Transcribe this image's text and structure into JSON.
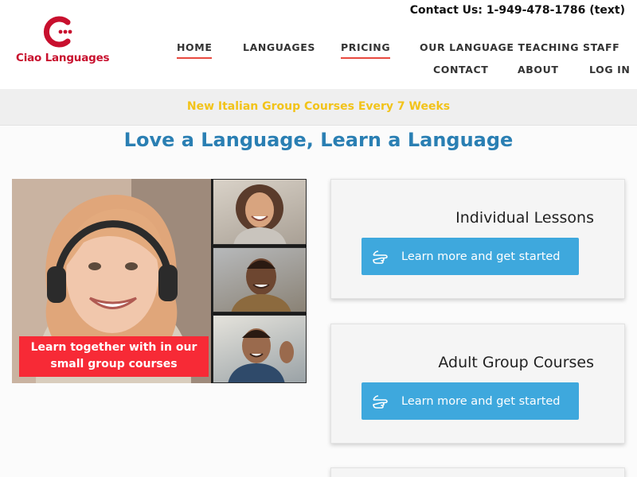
{
  "header": {
    "contact": "Contact Us: 1-949-478-1786 (text)",
    "logo_text": "Ciao Languages",
    "nav": [
      {
        "label": "HOME",
        "active": true
      },
      {
        "label": "LANGUAGES",
        "active": false
      },
      {
        "label": "PRICING",
        "active": true
      },
      {
        "label": "OUR LANGUAGE TEACHING STAFF",
        "active": false
      },
      {
        "label": "CONTACT",
        "active": false
      },
      {
        "label": "ABOUT",
        "active": false
      },
      {
        "label": "LOG IN",
        "active": false
      }
    ]
  },
  "announcement": "New Italian Group Courses Every 7 Weeks",
  "headline": "Love a Language, Learn a Language",
  "hero": {
    "badge_line1": "Learn together with in our",
    "badge_line2": "small group courses"
  },
  "cards": [
    {
      "title": "Individual Lessons",
      "button": "Learn more and get started"
    },
    {
      "title": "Adult Group Courses",
      "button": "Learn more and get started"
    }
  ],
  "colors": {
    "brand_red": "#c8102e",
    "nav_underline": "#e8493f",
    "announcement": "#f2c319",
    "headline_blue": "#2a7fb3",
    "button_blue": "#3ea8dd",
    "badge_red": "#f72a36"
  },
  "icons": {
    "logo": "ciao-c-logo-icon",
    "button": "pointing-hand-icon"
  }
}
